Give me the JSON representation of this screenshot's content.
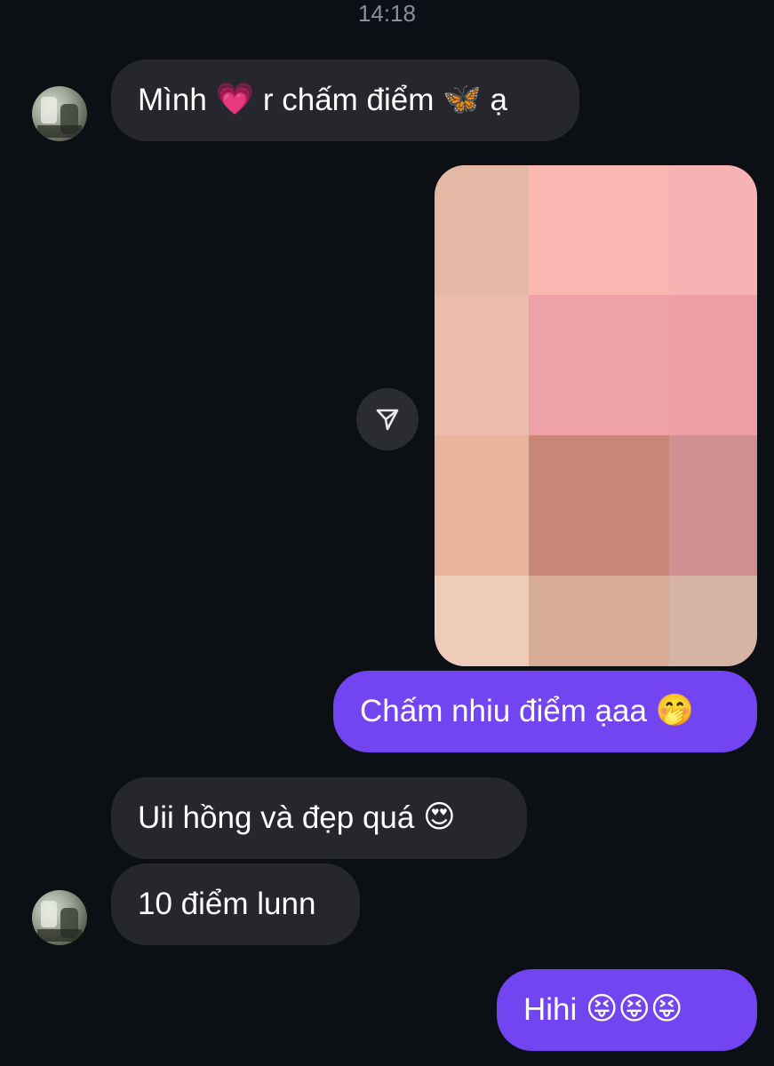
{
  "chat": {
    "timestamp": "14:18",
    "messages": [
      {
        "sender": "other",
        "text_before": "Mình ",
        "emoji_1": "💗",
        "text_middle": " r chấm điểm ",
        "emoji_2": "🦋",
        "text_after": " ạ"
      },
      {
        "sender": "me",
        "type": "image",
        "description_icon": "pixelated-photo"
      },
      {
        "sender": "me",
        "text": "Chấm nhiu điểm ạaa ",
        "emoji": "🤭"
      },
      {
        "sender": "other",
        "text": "Uii hồng và đẹp quá ",
        "emoji": "😍"
      },
      {
        "sender": "other",
        "text": "10 điểm lunn"
      },
      {
        "sender": "me",
        "text": "Hihi ",
        "emojis": "😝😝😝"
      }
    ]
  },
  "photo_tiles": [
    "#e3b8a4",
    "#fbb8b2",
    "#f7b3b4",
    "#edbcaa",
    "#eea2a8",
    "#ee9fa6",
    "#e8b49c",
    "#c78676",
    "#d08f91",
    "#efccb9",
    "#d7ad98",
    "#d6b3a4"
  ],
  "colors": {
    "background": "#0c0f14",
    "incoming_bubble": "#25272c",
    "outgoing_bubble": "#7345f0",
    "timestamp_text": "#8b8f96"
  },
  "icons": {
    "share": "share-send-icon",
    "avatar": "contact-avatar"
  }
}
